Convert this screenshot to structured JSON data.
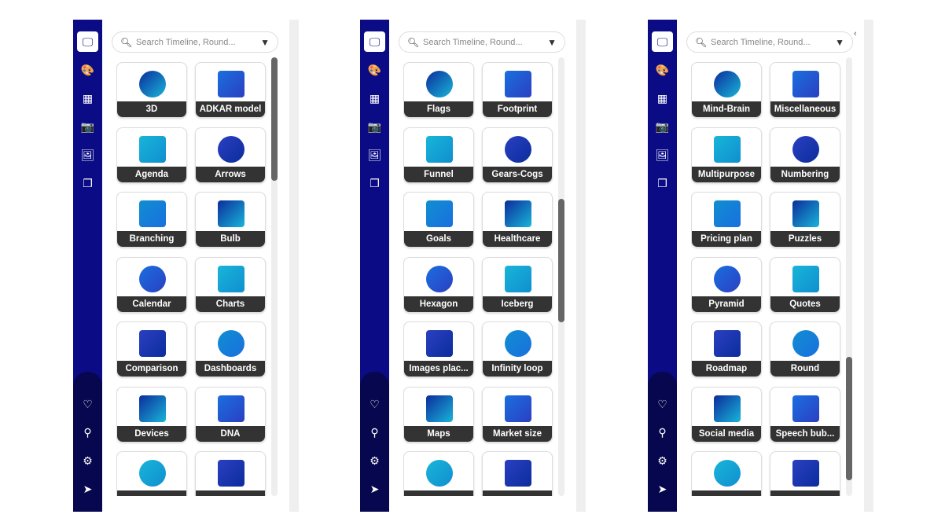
{
  "search": {
    "placeholder": "Search Timeline, Round..."
  },
  "sidebar": {
    "top_icons": [
      "presentation-icon",
      "palette-icon",
      "grid-icon",
      "camera-icon",
      "image-icon",
      "gallery-icon"
    ],
    "bottom_icons": [
      "heart-icon",
      "stamp-icon",
      "gear-icon",
      "send-icon"
    ]
  },
  "colors": {
    "sidebar": "#0b0b85",
    "sidebar_bottom": "#07074f",
    "label_bar": "#333333",
    "accent": "#1a4fd8"
  },
  "panels": [
    {
      "scroll_fraction": 0.0,
      "cards": [
        "3D",
        "ADKAR model",
        "Agenda",
        "Arrows",
        "Branching",
        "Bulb",
        "Calendar",
        "Charts",
        "Comparison",
        "Dashboards",
        "Devices",
        "DNA",
        "",
        ""
      ]
    },
    {
      "scroll_fraction": 0.45,
      "cards": [
        "Flags",
        "Footprint",
        "Funnel",
        "Gears-Cogs",
        "Goals",
        "Healthcare",
        "Hexagon",
        "Iceberg",
        "Images plac...",
        "Infinity loop",
        "Maps",
        "Market size",
        "",
        ""
      ]
    },
    {
      "scroll_fraction": 0.95,
      "collapse_icon": "chevron-left-icon",
      "cards": [
        "Mind-Brain",
        "Miscellaneous",
        "Multipurpose",
        "Numbering",
        "Pricing plan",
        "Puzzles",
        "Pyramid",
        "Quotes",
        "Roadmap",
        "Round",
        "Social media",
        "Speech bub...",
        "",
        ""
      ]
    }
  ]
}
